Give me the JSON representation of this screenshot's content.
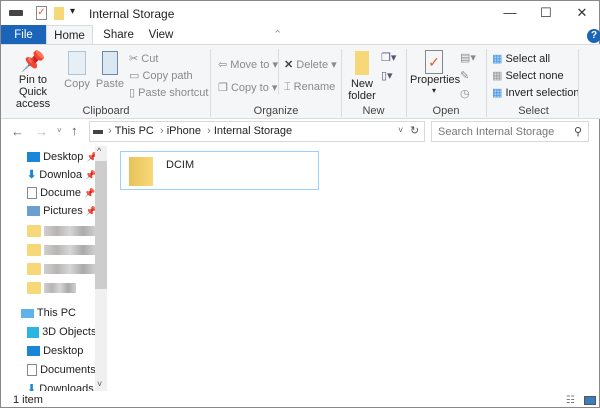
{
  "window": {
    "title": "Internal Storage",
    "minimize": "—",
    "maximize": "☐",
    "close": "✕"
  },
  "tabs": [
    {
      "label": "File"
    },
    {
      "label": "Home"
    },
    {
      "label": "Share"
    },
    {
      "label": "View"
    }
  ],
  "ribbon": {
    "clipboard": {
      "label": "Clipboard",
      "pin": "Pin to Quick access",
      "copy": "Copy",
      "paste": "Paste",
      "cut": "Cut",
      "copy_path": "Copy path",
      "paste_shortcut": "Paste shortcut"
    },
    "organize": {
      "label": "Organize",
      "move_to": "Move to",
      "copy_to": "Copy to",
      "delete": "Delete",
      "rename": "Rename"
    },
    "new": {
      "label": "New",
      "new_folder": "New folder"
    },
    "open": {
      "label": "Open",
      "properties": "Properties"
    },
    "select": {
      "label": "Select",
      "select_all": "Select all",
      "select_none": "Select none",
      "invert": "Invert selection"
    }
  },
  "address": {
    "crumbs": [
      "This PC",
      "iPhone",
      "Internal Storage"
    ],
    "search_placeholder": "Search Internal Storage"
  },
  "nav": {
    "quick": [
      "Desktop",
      "Downloa",
      "Docume",
      "Pictures"
    ],
    "this_pc": "This PC",
    "pc_items": [
      "3D Objects",
      "Desktop",
      "Documents",
      "Downloads"
    ]
  },
  "content": {
    "items": [
      {
        "name": "DCIM",
        "type": "folder"
      }
    ]
  },
  "status": {
    "count": "1 item"
  },
  "colors": {
    "file_tab": "#1a65b8",
    "selection_border": "#99d1ff",
    "folder": "#f7d878"
  }
}
